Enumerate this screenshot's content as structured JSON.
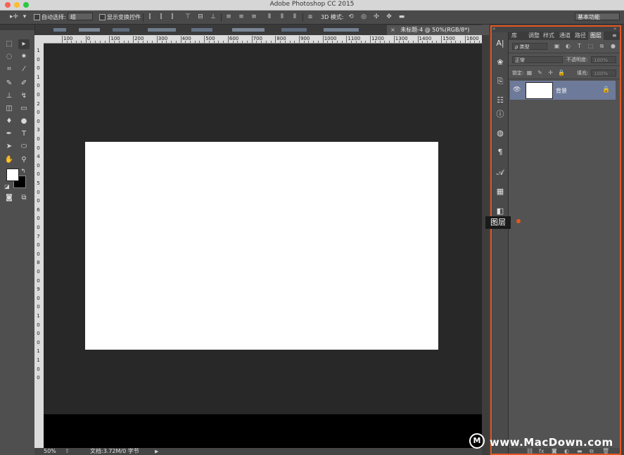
{
  "window": {
    "title": "Adobe Photoshop CC 2015",
    "traffic_lights": [
      "#fc5f57",
      "#fdbc2e",
      "#28c840"
    ]
  },
  "options_bar": {
    "auto_select_label": "自动选择:",
    "auto_select_value": "组",
    "show_transform_label": "显示变换控件",
    "mode_3d_label": "3D 模式:",
    "workspace_value": "基本功能"
  },
  "document": {
    "tab_title": "未标题-4 @ 50%(RGB/8*)",
    "tab_close": "×",
    "zoom": "50%",
    "doc_info": "文档:3.72M/0 字节"
  },
  "ruler": {
    "top_labels": [
      "100",
      "0",
      "100",
      "200",
      "300",
      "400",
      "500",
      "600",
      "700",
      "800",
      "900",
      "1000",
      "1100",
      "1200",
      "1300",
      "1400",
      "1500",
      "1600"
    ],
    "left_labels": [
      "1",
      "0",
      "0",
      "1",
      "0",
      "0",
      "2",
      "0",
      "0",
      "3",
      "0",
      "0",
      "4",
      "0",
      "0",
      "5",
      "0",
      "0",
      "6",
      "0",
      "0",
      "7",
      "0",
      "0",
      "8",
      "0",
      "0",
      "9",
      "0",
      "0",
      "1",
      "0",
      "0",
      "0",
      "1",
      "1",
      "0",
      "0"
    ]
  },
  "layers_panel": {
    "tabs": [
      "库",
      "调整",
      "样式",
      "通道",
      "路径",
      "图层"
    ],
    "filter_label": "ρ 类型",
    "blend_mode": "正常",
    "opacity_label": "不透明度:",
    "opacity_value": "100%",
    "lock_label": "锁定:",
    "fill_label": "填充:",
    "fill_value": "100%",
    "layers": [
      {
        "name": "背景"
      }
    ]
  },
  "tooltip": {
    "text": "图层"
  },
  "watermark": {
    "logo": "M",
    "text": "www.MacDown.com"
  },
  "colors": {
    "highlight_frame": "#e4571f",
    "layer_selected": "#6e7a9a"
  }
}
